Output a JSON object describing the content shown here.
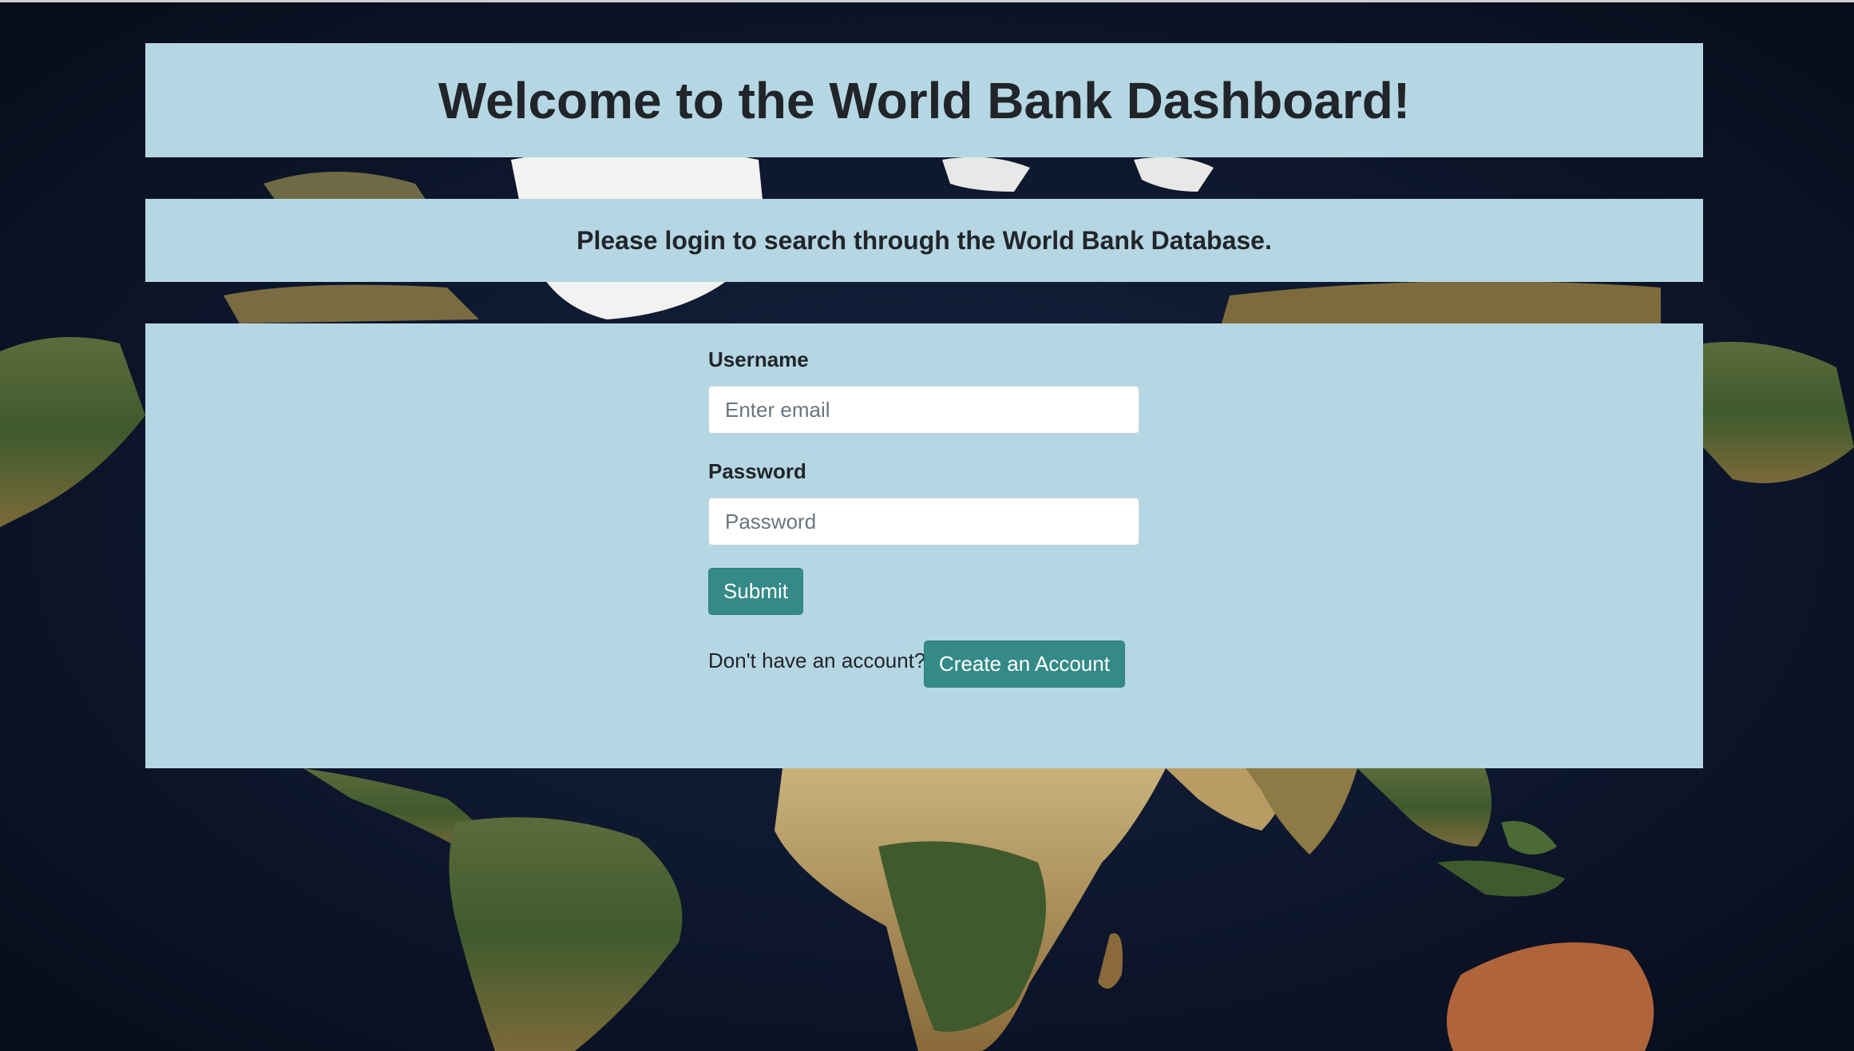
{
  "header": {
    "title": "Welcome to the World Bank Dashboard!"
  },
  "subtitle": {
    "text": "Please login to search through the World Bank Database."
  },
  "login_form": {
    "username_label": "Username",
    "username_placeholder": "Enter email",
    "username_value": "",
    "password_label": "Password",
    "password_placeholder": "Password",
    "password_value": "",
    "submit_label": "Submit",
    "signup_prompt": "Don't have an account?",
    "create_account_label": "Create an Account"
  },
  "colors": {
    "panel_background": "#b5d7e3",
    "button_background": "#358a87",
    "page_background": "#0a1226"
  },
  "background": {
    "icon": "world-map-satellite"
  }
}
